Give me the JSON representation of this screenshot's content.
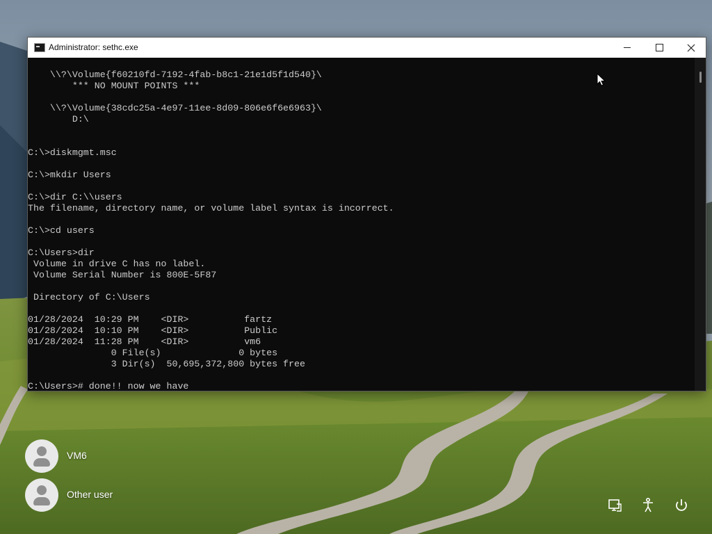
{
  "window": {
    "title": "Administrator: sethc.exe",
    "icon": "console-icon",
    "buttons": {
      "minimize": "minimize-icon",
      "maximize": "maximize-icon",
      "close": "close-icon"
    }
  },
  "console": {
    "lines": [
      "    \\\\?\\Volume{f60210fd-7192-4fab-b8c1-21e1d5f1d540}\\",
      "        *** NO MOUNT POINTS ***",
      "",
      "    \\\\?\\Volume{38cdc25a-4e97-11ee-8d09-806e6f6e6963}\\",
      "        D:\\",
      "",
      "",
      "C:\\>diskmgmt.msc",
      "",
      "C:\\>mkdir Users",
      "",
      "C:\\>dir C:\\\\users",
      "The filename, directory name, or volume label syntax is incorrect.",
      "",
      "C:\\>cd users",
      "",
      "C:\\Users>dir",
      " Volume in drive C has no label.",
      " Volume Serial Number is 800E-5F87",
      "",
      " Directory of C:\\Users",
      "",
      "01/28/2024  10:29 PM    <DIR>          fartz",
      "01/28/2024  10:10 PM    <DIR>          Public",
      "01/28/2024  11:28 PM    <DIR>          vm6",
      "               0 File(s)              0 bytes",
      "               3 Dir(s)  50,695,372,800 bytes free",
      "",
      "C:\\Users># done!! now we have"
    ]
  },
  "login": {
    "users": [
      {
        "name": "VM6",
        "icon": "user-avatar-icon"
      },
      {
        "name": "Other user",
        "icon": "user-avatar-icon"
      }
    ]
  },
  "tray": {
    "icons": [
      "network-icon",
      "accessibility-icon",
      "power-icon"
    ]
  },
  "colors": {
    "console_bg": "#0c0c0c",
    "console_fg": "#cccccc",
    "title_bar": "#ffffff"
  }
}
